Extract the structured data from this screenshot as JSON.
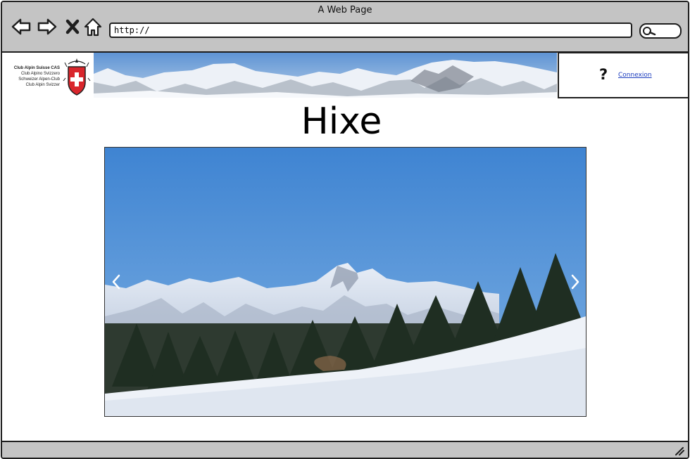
{
  "window": {
    "title": "A Web Page"
  },
  "toolbar": {
    "url": "http://",
    "icons": [
      "back-arrow-icon",
      "forward-arrow-icon",
      "close-x-icon",
      "home-icon",
      "search-icon"
    ]
  },
  "header": {
    "logo_lines": [
      "Club Alpin Suisse CAS",
      "Club Alpino Svizzero",
      "Schweizer Alpen-Club",
      "Club Alpin Svizzer"
    ],
    "login_label": "Connexion",
    "help_icon": "?"
  },
  "main": {
    "title": "Hixe"
  },
  "carousel": {
    "prev_icon": "chevron-left-icon",
    "next_icon": "chevron-right-icon"
  },
  "colors": {
    "chrome": "#c4c4c4",
    "link": "#1a3cbe",
    "sky": "#4a8fd6"
  }
}
